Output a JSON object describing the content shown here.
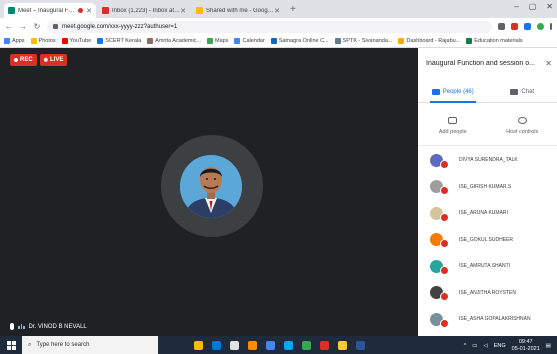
{
  "browser": {
    "tabs": [
      {
        "title": "Meet – Inaugural Function a...",
        "favicon_color": "#00897b",
        "recording": true,
        "active": true
      },
      {
        "title": "Inbox (1,223) - Inbox at vinodb...",
        "favicon_color": "#d93025",
        "recording": false,
        "active": false
      },
      {
        "title": "Shared with me - Google Drive",
        "favicon_color": "#fbbc04",
        "recording": false,
        "active": false
      }
    ],
    "new_tab": "+",
    "address": "meet.google.com/xxx-yyyy-zzz?authuser=1",
    "bookmarks": [
      {
        "label": "Apps",
        "color": "#4285f4"
      },
      {
        "label": "Photos",
        "color": "#fbbc04"
      },
      {
        "label": "YouTube",
        "color": "#ff0000"
      },
      {
        "label": "SCERT Kerala",
        "color": "#1a73e8"
      },
      {
        "label": "Amrita Academic...",
        "color": "#8d6e63"
      },
      {
        "label": "Maps",
        "color": "#34a853"
      },
      {
        "label": "Calendar",
        "color": "#4285f4"
      },
      {
        "label": "Samagra Online C...",
        "color": "#1565c0"
      },
      {
        "label": "SPTK - Sivananda...",
        "color": "#607d8b"
      },
      {
        "label": "Dashboard - Rajabu...",
        "color": "#f9ab00"
      },
      {
        "label": "Education materials",
        "color": "#0b8043"
      }
    ]
  },
  "meet": {
    "badges": [
      {
        "label": "REC",
        "icon": "record-dot-icon"
      },
      {
        "label": "LIVE",
        "icon": "live-icon"
      }
    ],
    "speaker_name": "Dr. VINOD B NEVALL"
  },
  "panel": {
    "title": "Inaugural Function and session o...",
    "tabs": [
      {
        "label": "People (46)",
        "icon": "people-icon",
        "active": true
      },
      {
        "label": "Chat",
        "icon": "chat-icon",
        "active": false
      }
    ],
    "actions": [
      {
        "label": "Add people",
        "icon": "add-people-icon"
      },
      {
        "label": "Host controls",
        "icon": "host-controls-icon"
      }
    ],
    "participants": [
      {
        "name": "DIVYA SURENDRA_TALK",
        "color": "#5c6bc0"
      },
      {
        "name": "ISE_GIRISH KUMAR.S",
        "color": "#9e9e9e"
      },
      {
        "name": "ISE_ARUNA KUMARI",
        "color": "#d4c49a"
      },
      {
        "name": "ISE_GOKUL SUDHEER",
        "color": "#f57c00"
      },
      {
        "name": "ISE_AMRUTA SHANTI",
        "color": "#26a69a"
      },
      {
        "name": "ISE_ANJITHA ROYSTEN",
        "color": "#424242"
      },
      {
        "name": "ISE_ASHA GOPALAKRISHNAN",
        "color": "#78909c"
      }
    ]
  },
  "taskbar": {
    "search_placeholder": "Type here to search",
    "apps": [
      "#ffb900",
      "#0078d7",
      "#e1e1e1",
      "#ff8c00",
      "#4285f4",
      "#00a4ef",
      "#34a853",
      "#d93025",
      "#ffc83d",
      "#2b579a"
    ],
    "tray_lang": "ENG",
    "time": "09:47",
    "date": "05-01-2021"
  }
}
